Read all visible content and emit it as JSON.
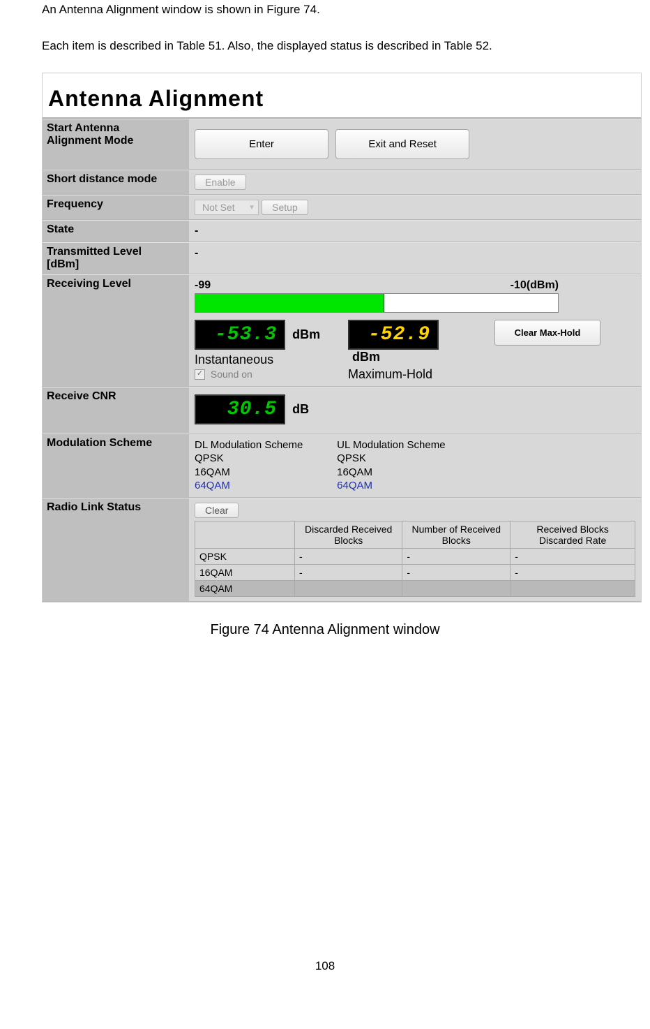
{
  "intro_line1": "An Antenna Alignment window is shown in Figure 74.",
  "intro_line2": "Each item is described in Table 51. Also, the displayed status is described in Table 52.",
  "window_title": "Antenna Alignment",
  "rows": {
    "start": {
      "label": "Start Antenna\nAlignment Mode",
      "enter_btn": "Enter",
      "exit_btn": "Exit and Reset"
    },
    "short_distance": {
      "label": "Short distance mode",
      "btn": "Enable"
    },
    "frequency": {
      "label": "Frequency",
      "select": "Not Set",
      "setup_btn": "Setup"
    },
    "state": {
      "label": "State",
      "value": "-"
    },
    "tx_level": {
      "label": "Transmitted Level\n[dBm]",
      "value": "-"
    },
    "recv_level": {
      "label": "Receiving Level",
      "scale_min": "-99",
      "scale_max": "-10(dBm)",
      "inst_value": "-53.3",
      "inst_unit": "dBm",
      "inst_caption": "Instantaneous",
      "max_value": "-52.9",
      "max_unit": "dBm",
      "max_caption": "Maximum-Hold",
      "clear_btn": "Clear Max-Hold",
      "sound_label": "Sound on"
    },
    "cnr": {
      "label": "Receive CNR",
      "value": "30.5",
      "unit": "dB"
    },
    "mod": {
      "label": "Modulation Scheme",
      "dl_header": "DL Modulation Scheme",
      "ul_header": "UL Modulation Scheme",
      "s1": "QPSK",
      "s2": "16QAM",
      "s3": "64QAM"
    },
    "radio": {
      "label": "Radio Link Status",
      "clear_btn": "Clear",
      "col_empty": "",
      "col1": "Discarded Received Blocks",
      "col2": "Number of Received Blocks",
      "col3": "Received Blocks Discarded Rate",
      "table": [
        {
          "name": "QPSK",
          "c1": "-",
          "c2": "-",
          "c3": "-"
        },
        {
          "name": "16QAM",
          "c1": "-",
          "c2": "-",
          "c3": "-"
        },
        {
          "name": "64QAM",
          "c1": "",
          "c2": "",
          "c3": ""
        }
      ]
    }
  },
  "figure_caption": "Figure 74 Antenna Alignment window",
  "page_number": "108"
}
